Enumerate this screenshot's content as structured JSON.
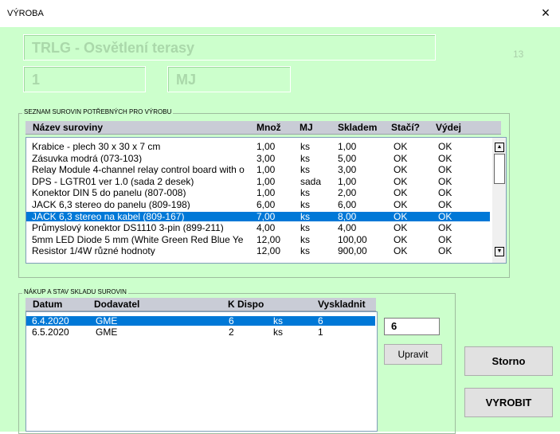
{
  "window": {
    "title": "VÝROBA",
    "close_symbol": "×"
  },
  "product": {
    "name": "TRLG - Osvětlení terasy",
    "quantity": "1",
    "unit": "MJ",
    "counter": "13"
  },
  "materials": {
    "caption": "SEZNAM SUROVIN POTŘEBNÝCH PRO VÝROBU",
    "columns": [
      "Název suroviny",
      "Množ",
      "MJ",
      "Skladem",
      "Stačí?",
      "Výdej"
    ],
    "rows": [
      [
        "Krabice - plech 30 x 30 x 7 cm",
        "1,00",
        "ks",
        "1,00",
        "OK",
        "OK"
      ],
      [
        "Zásuvka modrá (073-103)",
        "3,00",
        "ks",
        "5,00",
        "OK",
        "OK"
      ],
      [
        "Relay Module 4-channel relay control board with o",
        "1,00",
        "ks",
        "3,00",
        "OK",
        "OK"
      ],
      [
        "DPS - LGTR01 ver 1.0 (sada 2 desek)",
        "1,00",
        "sada",
        "1,00",
        "OK",
        "OK"
      ],
      [
        "Konektor DIN 5 do panelu (807-008)",
        "1,00",
        "ks",
        "2,00",
        "OK",
        "OK"
      ],
      [
        "JACK 6,3 stereo do panelu (809-198)",
        "6,00",
        "ks",
        "6,00",
        "OK",
        "OK"
      ],
      [
        "JACK 6,3 stereo na kabel (809-167)",
        "7,00",
        "ks",
        "8,00",
        "OK",
        "OK"
      ],
      [
        "Průmyslový konektor DS1110 3-pin (899-211)",
        "4,00",
        "ks",
        "4,00",
        "OK",
        "OK"
      ],
      [
        "5mm LED Diode 5 mm (White Green Red Blue Ye",
        "12,00",
        "ks",
        "100,00",
        "OK",
        "OK"
      ],
      [
        "Resistor 1/4W různé hodnoty",
        "12,00",
        "ks",
        "900,00",
        "OK",
        "OK"
      ]
    ],
    "selected_index": 6
  },
  "purchases": {
    "caption": "NÁKUP A STAV SKLADU SUROVIN",
    "columns": [
      "Datum",
      "Dodavatel",
      "K Dispo",
      "Vyskladnit"
    ],
    "rows": [
      [
        "6.4.2020",
        "GME",
        "6",
        "ks",
        "6"
      ],
      [
        "6.5.2020",
        "GME",
        "2",
        "ks",
        "1"
      ]
    ],
    "selected_index": 0
  },
  "controls": {
    "quantity_value": "6",
    "edit_label": "Upravit",
    "cancel_label": "Storno",
    "produce_label": "VYROBIT"
  }
}
